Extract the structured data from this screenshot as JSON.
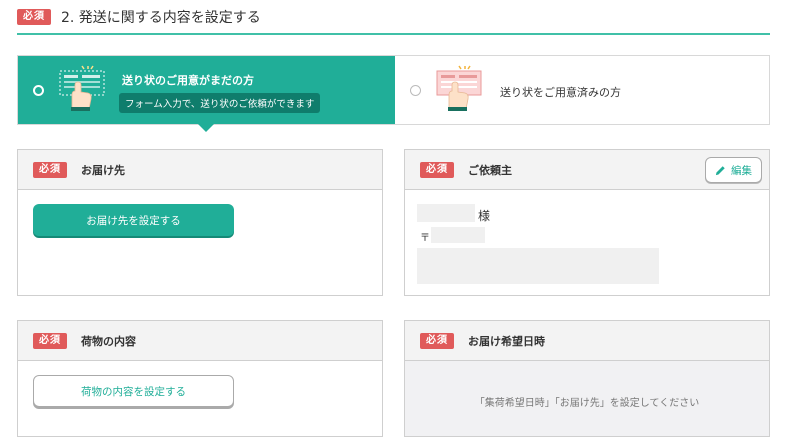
{
  "section": {
    "badge": "必須",
    "title": "2. 発送に関する内容を設定する"
  },
  "options": {
    "a": {
      "label": "送り状のご用意がまだの方",
      "description": "フォーム入力で、送り状のご依頼ができます",
      "selected": true,
      "icon": "shipping-slip-hand-icon"
    },
    "b": {
      "label": "送り状をご用意済みの方",
      "selected": false,
      "icon": "shipping-slip-hand-icon"
    }
  },
  "cards": {
    "destination": {
      "badge": "必須",
      "title": "お届け先",
      "button": "お届け先を設定する"
    },
    "requester": {
      "badge": "必須",
      "title": "ご依頼主",
      "edit": "編集",
      "honorific": "様",
      "postal_mark": "〒"
    },
    "package": {
      "badge": "必須",
      "title": "荷物の内容",
      "button": "荷物の内容を設定する"
    },
    "delivery_date": {
      "badge": "必須",
      "title": "お届け希望日時",
      "notice": "「集荷希望日時」「お届け先」を設定してください"
    }
  },
  "colors": {
    "accent": "#20ae98",
    "required": "#e05a5a",
    "rule": "#40c0a8"
  }
}
